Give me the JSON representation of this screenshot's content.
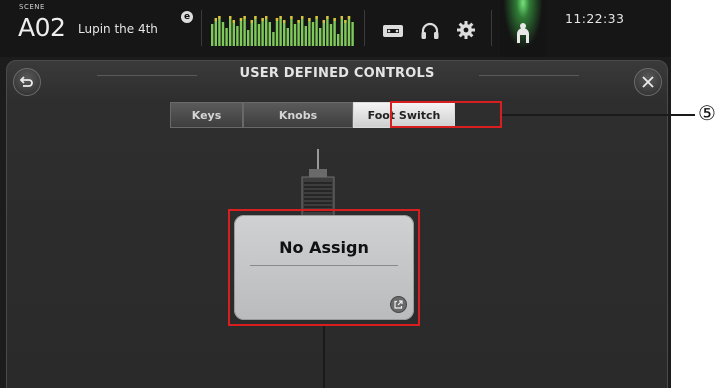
{
  "topbar": {
    "scene_label": "SCENE",
    "scene_number": "A02",
    "scene_name": "Lupin the 4th",
    "clock": "11:22:33"
  },
  "panel": {
    "title": "USER DEFINED CONTROLS",
    "tabs": [
      {
        "label": "Keys",
        "active": false
      },
      {
        "label": "Knobs",
        "active": false
      },
      {
        "label": "Foot Switch",
        "active": true
      }
    ]
  },
  "foot_switch": {
    "assign_label": "No Assign"
  },
  "annotations": {
    "callout": "⑤",
    "highlight_color": "#d81e1e"
  },
  "icons": [
    "back-icon",
    "close-icon",
    "recorder-icon",
    "headphones-icon",
    "gear-icon",
    "user-icon",
    "edit-icon",
    "foot-pedal-icon"
  ],
  "colors": {
    "user_button_glow": "#74e27a",
    "meter_green": "#7fc95a",
    "meter_yellow": "#d9c23a"
  }
}
